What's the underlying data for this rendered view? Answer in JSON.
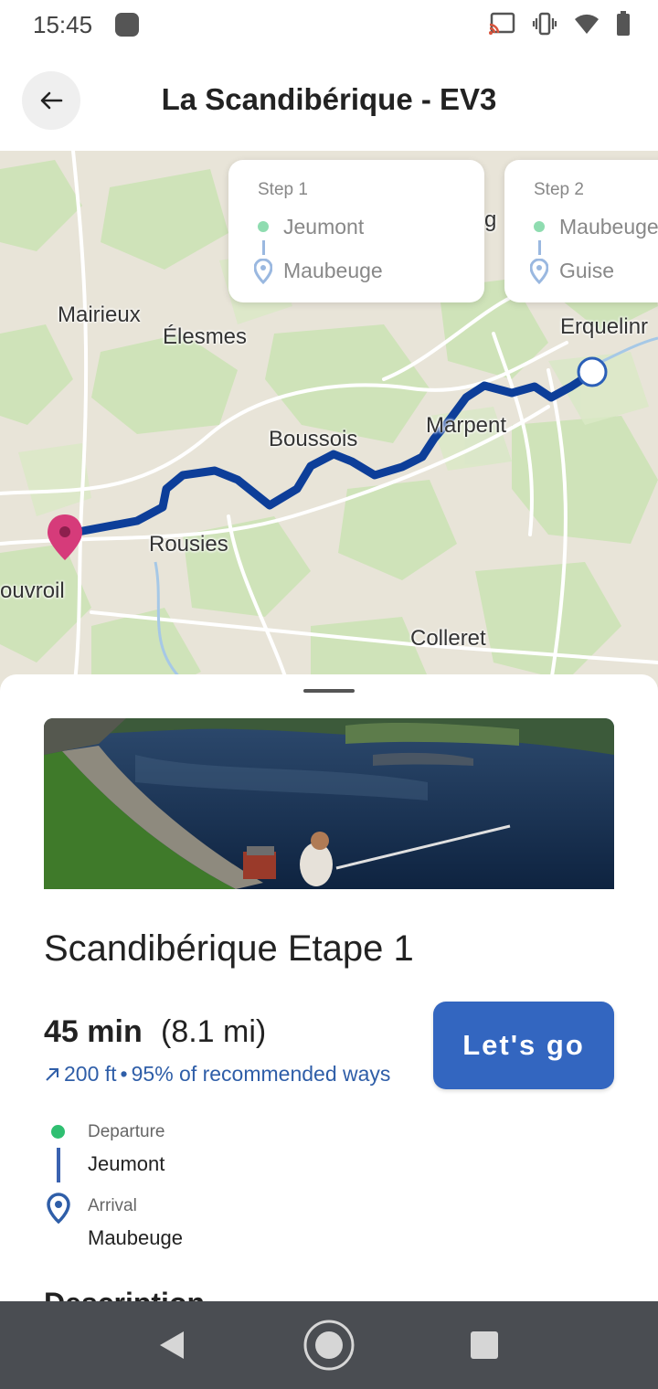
{
  "status_bar": {
    "time": "15:45",
    "icons": [
      "cast-icon",
      "vibrate-icon",
      "wifi-icon",
      "battery-icon"
    ]
  },
  "header": {
    "title": "La Scandibérique - EV3",
    "back_icon": "arrow-left-icon"
  },
  "map": {
    "places": [
      "Mairieux",
      "Élesmes",
      "Boussois",
      "Marpent",
      "Rousies",
      "ouvroil",
      "Colleret",
      "Erquelinr",
      "g"
    ],
    "route_color": "#0d3e99",
    "start_marker_color": "#d63b7a",
    "steps": [
      {
        "label": "Step 1",
        "from": "Jeumont",
        "to": "Maubeuge"
      },
      {
        "label": "Step 2",
        "from": "Maubeuge",
        "to": "Guise"
      }
    ]
  },
  "route": {
    "title": "Scandibérique Etape 1",
    "duration": "45 min",
    "distance": "(8.1 mi)",
    "elevation": "200 ft",
    "separator": "•",
    "recommended": "95% of recommended ways",
    "go_label": "Let's go",
    "departure_label": "Departure",
    "departure": "Jeumont",
    "arrival_label": "Arrival",
    "arrival": "Maubeuge",
    "description_heading": "Description"
  },
  "colors": {
    "accent": "#3366c0",
    "link": "#2f5ea8",
    "departure_dot": "#2fbf71"
  }
}
